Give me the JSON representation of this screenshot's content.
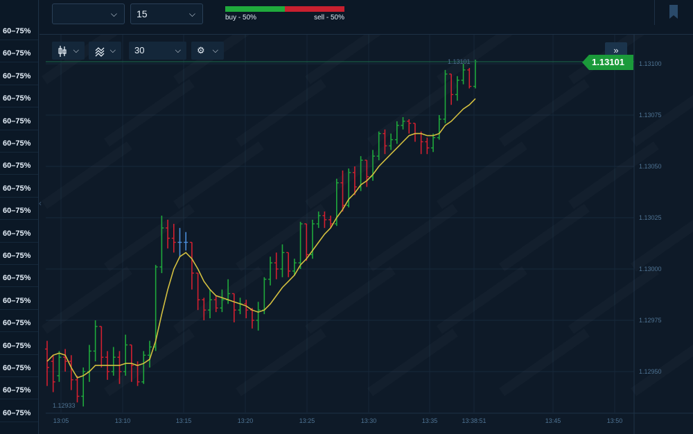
{
  "left_panel": {
    "rows": [
      "60–75%",
      "60–75%",
      "60–75%",
      "60–75%",
      "60–75%",
      "60–75%",
      "60–75%",
      "60–75%",
      "60–75%",
      "60–75%",
      "60–75%",
      "60–75%",
      "60–75%",
      "60–75%",
      "60–75%",
      "60–75%",
      "60–75%",
      "60–75%"
    ]
  },
  "top_bar": {
    "asset_select": "",
    "timeframe_select": "15",
    "sentiment": {
      "buy_label": "buy - 50%",
      "sell_label": "sell - 50%",
      "buy_fraction": 0.5
    }
  },
  "toolbar": {
    "candle_type_icon": "candles-icon",
    "indicators_icon": "indicators-icon",
    "period_select": "30",
    "settings_icon": "gear-icon"
  },
  "collapse_icon": "double-chevron-right-icon",
  "current_price": "1.13101",
  "colors": {
    "bull": "#1faa3c",
    "bear": "#d42030",
    "neutral": "#4a8cd8",
    "ma": "#d4c040",
    "price_tag": "#1b9a3a"
  },
  "chart_data": {
    "type": "candlestick",
    "y_ticks": [
      "1.13100",
      "1.13075",
      "1.13050",
      "1.13025",
      "1.13000",
      "1.12975",
      "1.12950"
    ],
    "x_ticks": [
      "13:05",
      "13:10",
      "13:15",
      "13:20",
      "13:25",
      "13:30",
      "13:35",
      "13:38:51",
      "13:45",
      "13:50"
    ],
    "high_label": "1.13101",
    "low_label": "1.12933",
    "ylim": [
      1.1293,
      1.1311
    ],
    "candles": [
      [
        1.12961,
        1.12952,
        1.12965,
        1.12943
      ],
      [
        1.12955,
        1.12945,
        1.12958,
        1.1294
      ],
      [
        1.12948,
        1.12957,
        1.1296,
        1.12945
      ],
      [
        1.12957,
        1.12955,
        1.12961,
        1.1295
      ],
      [
        1.12955,
        1.12946,
        1.12958,
        1.12941
      ],
      [
        1.12946,
        1.12938,
        1.12948,
        1.12935
      ],
      [
        1.12938,
        1.1295,
        1.12952,
        1.12933
      ],
      [
        1.1295,
        1.1296,
        1.12963,
        1.12945
      ],
      [
        1.1296,
        1.12972,
        1.12975,
        1.12955
      ],
      [
        1.12972,
        1.12957,
        1.12972,
        1.12952
      ],
      [
        1.12957,
        1.1295,
        1.1296,
        1.12946
      ],
      [
        1.1295,
        1.12957,
        1.12962,
        1.12948
      ],
      [
        1.12957,
        1.1295,
        1.1296,
        1.12944
      ],
      [
        1.1295,
        1.12963,
        1.12968,
        1.12948
      ],
      [
        1.12963,
        1.12953,
        1.12963,
        1.12945
      ],
      [
        1.12953,
        1.12945,
        1.12955,
        1.12943
      ],
      [
        1.12945,
        1.12958,
        1.1296,
        1.12944
      ],
      [
        1.12958,
        1.12962,
        1.12965,
        1.12952
      ],
      [
        1.12962,
        1.13001,
        1.13002,
        1.1296
      ],
      [
        1.13001,
        1.1302,
        1.13026,
        1.12998
      ],
      [
        1.1302,
        1.13015,
        1.13024,
        1.1301
      ],
      [
        1.13015,
        1.13013,
        1.13022,
        1.13008
      ],
      [
        1.13013,
        1.13013,
        1.1302,
        1.13006
      ],
      [
        1.13013,
        1.13013,
        1.13018,
        1.13009
      ],
      [
        1.13013,
        1.12998,
        1.13013,
        1.1299
      ],
      [
        1.12998,
        1.12985,
        1.12998,
        1.1298
      ],
      [
        1.12985,
        1.1298,
        1.12986,
        1.12975
      ],
      [
        1.1298,
        1.12985,
        1.1299,
        1.12976
      ],
      [
        1.12985,
        1.12981,
        1.12987,
        1.12979
      ],
      [
        1.12981,
        1.12985,
        1.1299,
        1.12979
      ],
      [
        1.12985,
        1.12988,
        1.12995,
        1.12983
      ],
      [
        1.12988,
        1.1298,
        1.12988,
        1.12974
      ],
      [
        1.1298,
        1.12983,
        1.12986,
        1.12978
      ],
      [
        1.12983,
        1.1298,
        1.12985,
        1.12976
      ],
      [
        1.1298,
        1.12975,
        1.12981,
        1.12971
      ],
      [
        1.12975,
        1.1298,
        1.12984,
        1.1297
      ],
      [
        1.1298,
        1.12995,
        1.12996,
        1.12978
      ],
      [
        1.12995,
        1.13003,
        1.13006,
        1.12992
      ],
      [
        1.13003,
        1.13,
        1.13008,
        1.12995
      ],
      [
        1.13,
        1.13008,
        1.13012,
        1.12996
      ],
      [
        1.13008,
        1.12999,
        1.13008,
        1.12996
      ],
      [
        1.12999,
        1.13003,
        1.13005,
        1.12997
      ],
      [
        1.13003,
        1.13022,
        1.13023,
        1.13
      ],
      [
        1.13022,
        1.13007,
        1.13022,
        1.13004
      ],
      [
        1.13007,
        1.13022,
        1.13024,
        1.13005
      ],
      [
        1.13022,
        1.13026,
        1.13028,
        1.1302
      ],
      [
        1.13026,
        1.13024,
        1.13028,
        1.1302
      ],
      [
        1.13024,
        1.13022,
        1.13026,
        1.1302
      ],
      [
        1.13022,
        1.13042,
        1.13044,
        1.13021
      ],
      [
        1.13042,
        1.13031,
        1.13048,
        1.13028
      ],
      [
        1.13031,
        1.13047,
        1.13049,
        1.1303
      ],
      [
        1.13047,
        1.1304,
        1.1305,
        1.13036
      ],
      [
        1.1304,
        1.13053,
        1.13055,
        1.13038
      ],
      [
        1.13053,
        1.13045,
        1.13053,
        1.1304
      ],
      [
        1.13045,
        1.13055,
        1.13058,
        1.13043
      ],
      [
        1.13055,
        1.13066,
        1.13067,
        1.13053
      ],
      [
        1.13066,
        1.1306,
        1.13068,
        1.13056
      ],
      [
        1.1306,
        1.13063,
        1.13066,
        1.13058
      ],
      [
        1.13063,
        1.1307,
        1.13072,
        1.13061
      ],
      [
        1.1307,
        1.13072,
        1.13074,
        1.13068
      ],
      [
        1.13072,
        1.13071,
        1.13073,
        1.13066
      ],
      [
        1.13071,
        1.13066,
        1.13071,
        1.13062
      ],
      [
        1.13066,
        1.13062,
        1.13067,
        1.13056
      ],
      [
        1.13062,
        1.13059,
        1.13064,
        1.13056
      ],
      [
        1.13059,
        1.13064,
        1.13066,
        1.13057
      ],
      [
        1.13064,
        1.13073,
        1.13075,
        1.13063
      ],
      [
        1.13073,
        1.13095,
        1.13097,
        1.13071
      ],
      [
        1.13095,
        1.13085,
        1.13095,
        1.1308
      ],
      [
        1.13085,
        1.13092,
        1.13094,
        1.13082
      ],
      [
        1.13092,
        1.13097,
        1.131,
        1.1309
      ],
      [
        1.13097,
        1.13089,
        1.13098,
        1.13088
      ],
      [
        1.13089,
        1.13101,
        1.13102,
        1.13088
      ]
    ],
    "moving_average": [
      1.12955,
      1.12958,
      1.12959,
      1.12958,
      1.12952,
      1.12947,
      1.12948,
      1.1295,
      1.12953,
      1.12953,
      1.12953,
      1.12953,
      1.12953,
      1.12954,
      1.12954,
      1.12953,
      1.12954,
      1.12956,
      1.12965,
      1.12978,
      1.1299,
      1.13,
      1.13006,
      1.13008,
      1.13005,
      1.13,
      1.12994,
      1.1299,
      1.12987,
      1.12986,
      1.12985,
      1.12984,
      1.12983,
      1.12982,
      1.1298,
      1.12979,
      1.1298,
      1.12983,
      1.12987,
      1.12991,
      1.12994,
      1.12997,
      1.13002,
      1.13005,
      1.13009,
      1.13013,
      1.13017,
      1.1302,
      1.13025,
      1.13029,
      1.13034,
      1.13037,
      1.13041,
      1.13043,
      1.13046,
      1.1305,
      1.13053,
      1.13056,
      1.13059,
      1.13062,
      1.13065,
      1.13066,
      1.13066,
      1.13065,
      1.13065,
      1.13066,
      1.1307,
      1.13072,
      1.13075,
      1.13078,
      1.1308,
      1.13083
    ]
  }
}
